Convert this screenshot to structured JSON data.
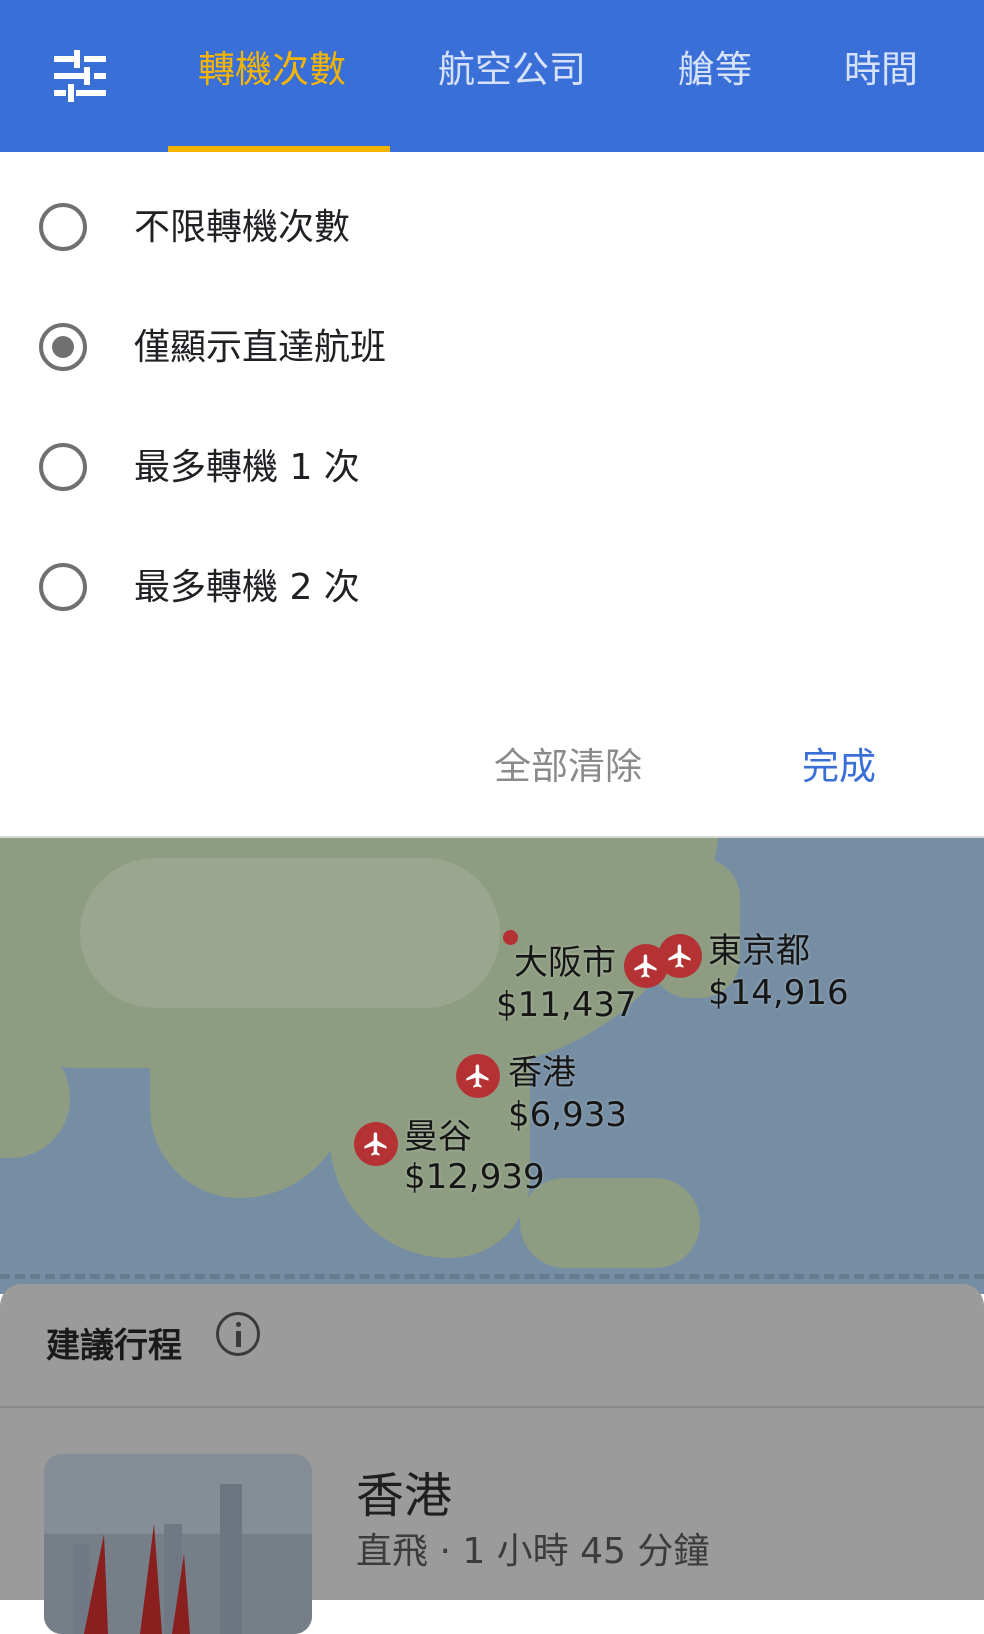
{
  "header": {
    "tabs": [
      {
        "label": "轉機次數",
        "active": true
      },
      {
        "label": "航空公司",
        "active": false
      },
      {
        "label": "艙等",
        "active": false
      },
      {
        "label": "時間",
        "active": false
      }
    ],
    "filter_icon": "sliders-icon",
    "active_color": "#f4b400",
    "bar_color": "#3a6fd8"
  },
  "stops": {
    "options": [
      {
        "label": "不限轉機次數",
        "selected": false
      },
      {
        "label": "僅顯示直達航班",
        "selected": true
      },
      {
        "label": "最多轉機 1 次",
        "selected": false
      },
      {
        "label": "最多轉機 2 次",
        "selected": false
      }
    ],
    "clear_label": "全部清除",
    "done_label": "完成"
  },
  "map": {
    "destinations": [
      {
        "name": "東京都",
        "price": "$14,916"
      },
      {
        "name": "大阪市",
        "price": "$11,437"
      },
      {
        "name": "香港",
        "price": "$6,933"
      },
      {
        "name": "曼谷",
        "price": "$12,939"
      }
    ],
    "pin_icon": "airplane-icon",
    "pin_color": "#b53234"
  },
  "sheet": {
    "title": "建議行程",
    "info_icon": "info-icon",
    "card": {
      "name": "香港",
      "detail": "直飛 · 1 小時 45 分鐘"
    }
  }
}
